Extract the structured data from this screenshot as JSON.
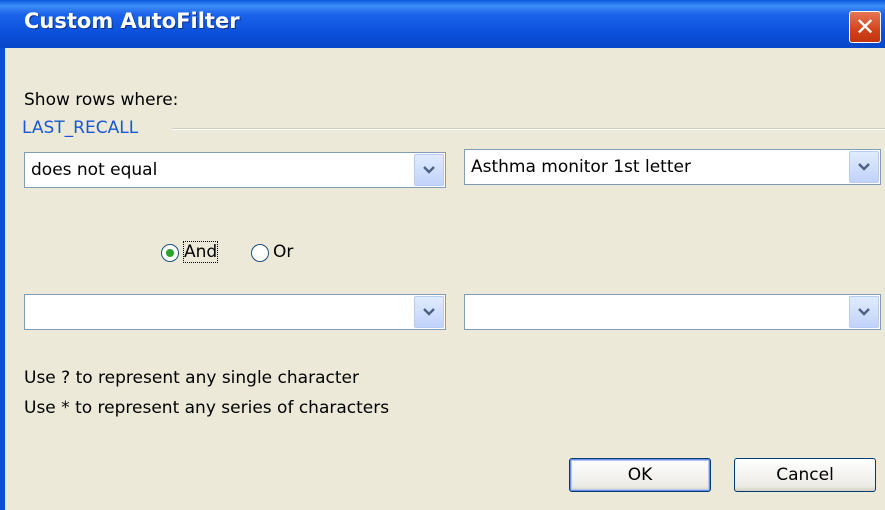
{
  "window": {
    "title": "Custom AutoFilter"
  },
  "labels": {
    "show_rows": "Show rows where:",
    "field_name": "LAST_RECALL",
    "hint1": "Use ? to represent any single character",
    "hint2": "Use * to represent any series of characters"
  },
  "condition1": {
    "operator": "does not equal",
    "value": "Asthma monitor 1st letter"
  },
  "logic": {
    "and_label": "And",
    "or_label": "Or",
    "selected": "And"
  },
  "condition2": {
    "operator": "",
    "value": ""
  },
  "buttons": {
    "ok": "OK",
    "cancel": "Cancel"
  },
  "colors": {
    "titlebar": "#0A4FD9",
    "field_label": "#1957D6",
    "radio_selected": "#2AA32A",
    "close_button": "#D3431B"
  }
}
